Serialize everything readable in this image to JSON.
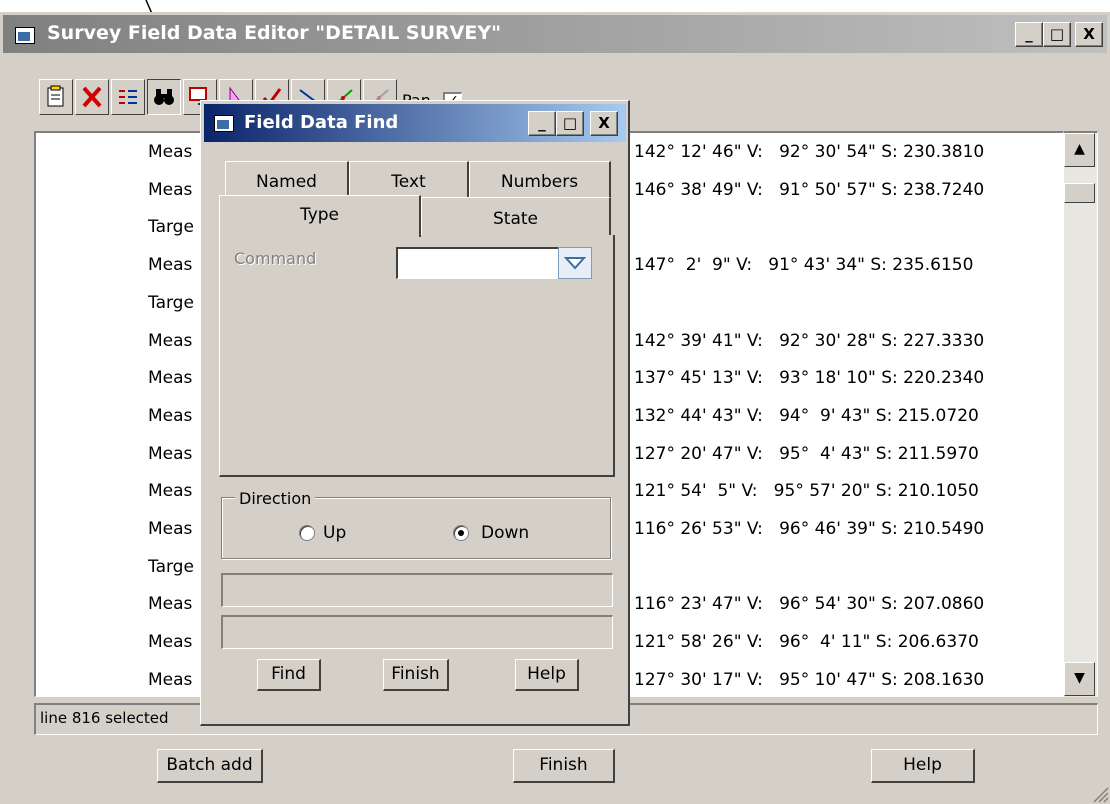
{
  "main_window": {
    "title": "Survey Field Data Editor \"DETAIL SURVEY\"",
    "caption_buttons": {
      "minimize": "_",
      "maximize": "□",
      "close": "X"
    },
    "toolbar": {
      "pan_label": "Pan",
      "pan_checked": "✓",
      "buttons": [
        "new-record",
        "delete",
        "insert-list",
        "find",
        "import",
        "measure",
        "check",
        "traverse",
        "graph",
        "graph-disabled"
      ]
    },
    "list": {
      "rows": [
        {
          "kind": "Meas",
          "vals": "142° 12' 46\" V:   92° 30' 54\" S: 230.3810"
        },
        {
          "kind": "Meas",
          "vals": "146° 38' 49\" V:   91° 50' 57\" S: 238.7240"
        },
        {
          "kind": "Targe",
          "vals": ""
        },
        {
          "kind": "Meas",
          "vals": "147°  2'  9\" V:   91° 43' 34\" S: 235.6150"
        },
        {
          "kind": "Targe",
          "vals": ""
        },
        {
          "kind": "Meas",
          "vals": "142° 39' 41\" V:   92° 30' 28\" S: 227.3330"
        },
        {
          "kind": "Meas",
          "vals": "137° 45' 13\" V:   93° 18' 10\" S: 220.2340"
        },
        {
          "kind": "Meas",
          "vals": "132° 44' 43\" V:   94°  9' 43\" S: 215.0720"
        },
        {
          "kind": "Meas",
          "vals": "127° 20' 47\" V:   95°  4' 43\" S: 211.5970"
        },
        {
          "kind": "Meas",
          "vals": "121° 54'  5\" V:   95° 57' 20\" S: 210.1050"
        },
        {
          "kind": "Meas",
          "vals": "116° 26' 53\" V:   96° 46' 39\" S: 210.5490"
        },
        {
          "kind": "Targe",
          "vals": ""
        },
        {
          "kind": "Meas",
          "vals": "116° 23' 47\" V:   96° 54' 30\" S: 207.0860"
        },
        {
          "kind": "Meas",
          "vals": "121° 58' 26\" V:   96°  4' 11\" S: 206.6370"
        },
        {
          "kind": "Meas",
          "vals": "127° 30' 17\" V:   95° 10' 47\" S: 208.1630"
        }
      ]
    },
    "status": "line 816 selected",
    "buttons": {
      "batch_add": "Batch add",
      "finish": "Finish",
      "help": "Help"
    }
  },
  "dialog": {
    "title": "Field Data Find",
    "tabs_back": [
      "Named",
      "Text",
      "Numbers"
    ],
    "tabs_front": [
      "Type",
      "State"
    ],
    "active_tab": "Type",
    "command_label": "Command",
    "command_value": "",
    "direction": {
      "label": "Direction",
      "up": "Up",
      "down": "Down",
      "selected": "Down"
    },
    "buttons": {
      "find": "Find",
      "finish": "Finish",
      "help": "Help"
    }
  }
}
